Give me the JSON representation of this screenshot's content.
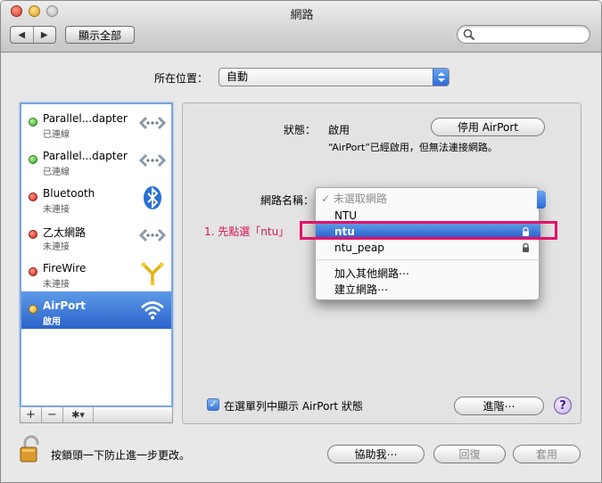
{
  "window": {
    "title": "網路"
  },
  "toolbar": {
    "back": "◀",
    "forward": "▶",
    "show_all": "顯示全部",
    "search_placeholder": ""
  },
  "location": {
    "label": "所在位置：",
    "value": "自動"
  },
  "services": [
    {
      "name": "Parallel...dapter",
      "status": "已連線",
      "dot": "green",
      "icon": "ethernet-icon",
      "selected": false
    },
    {
      "name": "Parallel...dapter",
      "status": "已連線",
      "dot": "green",
      "icon": "ethernet-icon",
      "selected": false
    },
    {
      "name": "Bluetooth",
      "status": "未連接",
      "dot": "red",
      "icon": "bluetooth-icon",
      "selected": false
    },
    {
      "name": "乙太網路",
      "status": "未連接",
      "dot": "red",
      "icon": "ethernet-icon",
      "selected": false
    },
    {
      "name": "FireWire",
      "status": "未連接",
      "dot": "red",
      "icon": "firewire-icon",
      "selected": false
    },
    {
      "name": "AirPort",
      "status": "啟用",
      "dot": "yellow",
      "icon": "wifi-icon",
      "selected": true
    }
  ],
  "sidebar_toolbar": {
    "add": "+",
    "remove": "−",
    "gear": "✱▾"
  },
  "detail": {
    "status_label": "狀態：",
    "status_value": "啟用",
    "turn_off_button": "停用 AirPort",
    "status_note": "“AirPort”已經啟用，但無法連接網路。",
    "network_name_label": "網路名稱：",
    "show_in_menubar_label": "在選單列中顯示 AirPort 狀態",
    "show_in_menubar_checked": true,
    "advanced_button": "進階⋯",
    "help": "?"
  },
  "network_menu": {
    "header": "✓ 未選取網路",
    "networks": [
      {
        "name": "NTU",
        "locked": false,
        "selected": false
      },
      {
        "name": "ntu",
        "locked": true,
        "selected": true
      },
      {
        "name": "ntu_peap",
        "locked": true,
        "selected": false
      }
    ],
    "join_other": "加入其他網路⋯",
    "create_network": "建立網路⋯"
  },
  "annotation": {
    "text": "1. 先點選「ntu」",
    "color": "#e6106a"
  },
  "bottom": {
    "lock_text": "按鎖頭一下防止進一步更改。",
    "assist_button": "協助我⋯",
    "revert_button": "回復",
    "apply_button": "套用"
  },
  "colors": {
    "selection": "#2b63cc",
    "sidebar_focus": "#7aa6de",
    "annotation": "#e6106a"
  }
}
